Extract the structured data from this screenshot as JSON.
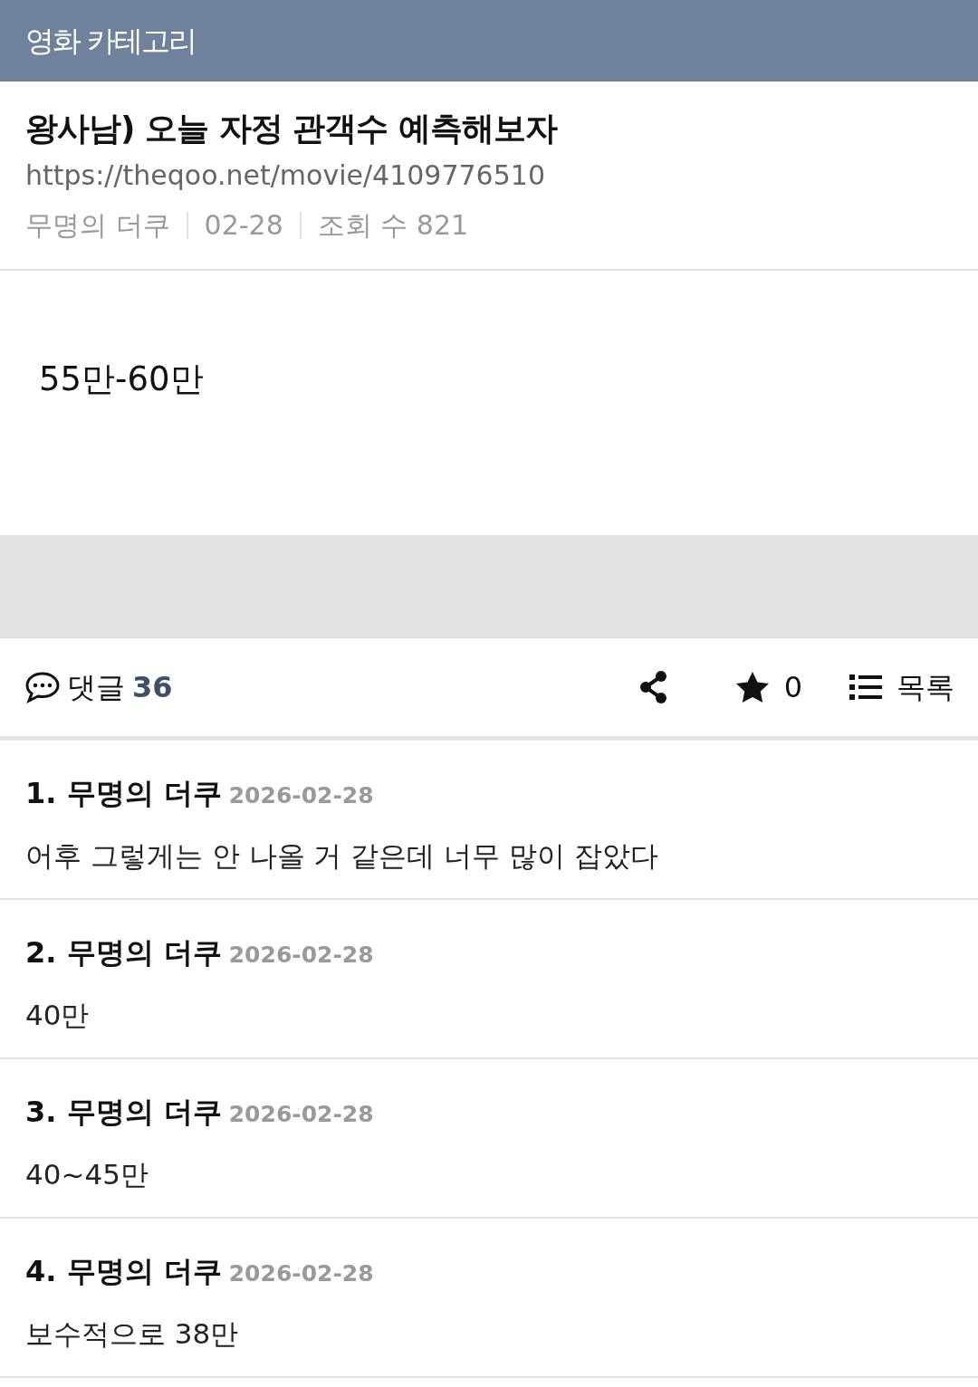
{
  "header": {
    "title": "영화 카테고리"
  },
  "post": {
    "title": "왕사남) 오늘 자정 관객수 예측해보자",
    "url": "https://theqoo.net/movie/4109776510",
    "author": "무명의 더쿠",
    "date": "02-28",
    "views": "조회 수 821",
    "body": "55만-60만"
  },
  "toolbar": {
    "comments_label": "댓글",
    "comments_count": "36",
    "favorite_count": "0",
    "list_label": "목록"
  },
  "comments": [
    {
      "number": "1.",
      "author": "무명의 더쿠",
      "date": "2026-02-28",
      "text": "어후 그렇게는 안 나올 거 같은데 너무 많이 잡았다"
    },
    {
      "number": "2.",
      "author": "무명의 더쿠",
      "date": "2026-02-28",
      "text": "40만"
    },
    {
      "number": "3.",
      "author": "무명의 더쿠",
      "date": "2026-02-28",
      "text": "40~45만"
    },
    {
      "number": "4.",
      "author": "무명의 더쿠",
      "date": "2026-02-28",
      "text": "보수적으로 38만"
    }
  ]
}
